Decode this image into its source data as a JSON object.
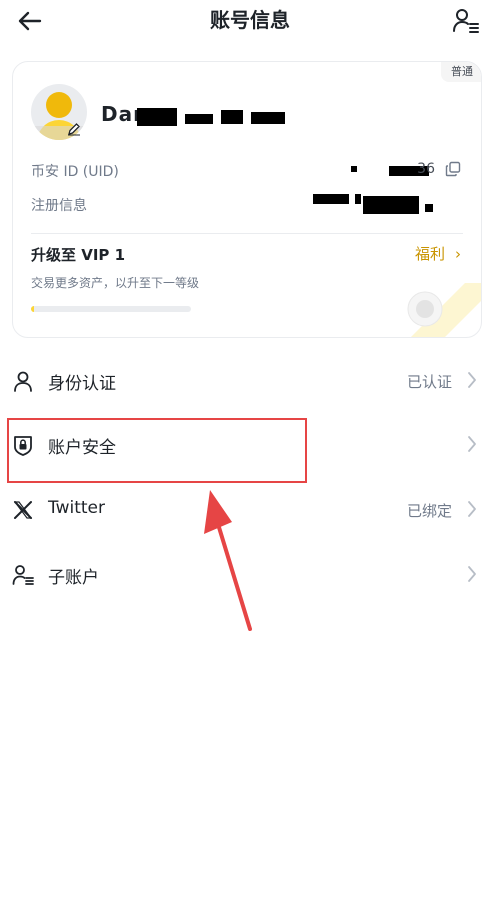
{
  "header": {
    "title": "账号信息",
    "back_icon": "arrow-left-icon",
    "right_icon": "sub-account-icon"
  },
  "profile": {
    "badge": "普通",
    "username_visible": "Dar",
    "uid_label": "币安 ID (UID)",
    "uid_value_visible": "36",
    "register_label": "注册信息",
    "vip_title": "升级至 VIP 1",
    "vip_link": "福利",
    "vip_desc": "交易更多资产，以升至下一等级",
    "vip_progress": 0.02
  },
  "menu": [
    {
      "label": "身份认证",
      "status": "已认证",
      "icon": "user-icon"
    },
    {
      "label": "账户安全",
      "status": "",
      "icon": "shield-lock-icon"
    },
    {
      "label": "Twitter",
      "status": "已绑定",
      "icon": "x-logo-icon"
    },
    {
      "label": "子账户",
      "status": "",
      "icon": "sub-account-icon"
    }
  ],
  "colors": {
    "accent": "#c99400",
    "brand_yellow": "#fcd535",
    "annotation_red": "#e64545",
    "text_primary": "#1e2329",
    "text_secondary": "#707a8a"
  }
}
